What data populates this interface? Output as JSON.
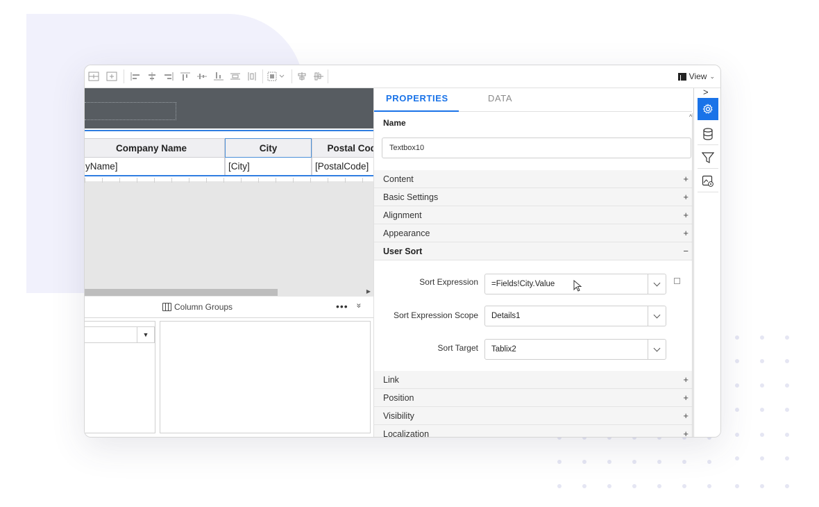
{
  "toolbar": {
    "icons": [
      "insert-row-above-icon",
      "insert-row-below-icon",
      "align-left-icon",
      "align-center-icon",
      "align-right-icon",
      "align-top-icon",
      "align-middle-icon",
      "align-bottom-icon",
      "distribute-horizontal-icon",
      "distribute-vertical-icon",
      "size-icon",
      "center-horizontal-icon",
      "center-vertical-icon"
    ],
    "view_label": "View"
  },
  "table": {
    "headers": [
      "Company Name",
      "City",
      "Postal Cod"
    ],
    "cells": [
      "yName]",
      "[City]",
      "[PostalCode]"
    ]
  },
  "groups": {
    "column_groups_label": "Column Groups",
    "more": "•••",
    "collapse": "»"
  },
  "properties": {
    "tabs": [
      "PROPERTIES",
      "DATA"
    ],
    "name_label": "Name",
    "name_value": "Textbox10",
    "categories_top": [
      {
        "label": "Content",
        "sign": "+"
      },
      {
        "label": "Basic Settings",
        "sign": "+"
      },
      {
        "label": "Alignment",
        "sign": "+"
      },
      {
        "label": "Appearance",
        "sign": "+"
      },
      {
        "label": "User Sort",
        "sign": "−"
      }
    ],
    "user_sort": {
      "sort_expression_label": "Sort Expression",
      "sort_expression_value": "=Fields!City.Value",
      "scope_label": "Sort Expression Scope",
      "scope_value": "Details1",
      "target_label": "Sort Target",
      "target_value": "Tablix2"
    },
    "categories_bottom": [
      {
        "label": "Link",
        "sign": "+"
      },
      {
        "label": "Position",
        "sign": "+"
      },
      {
        "label": "Visibility",
        "sign": "+"
      },
      {
        "label": "Localization",
        "sign": "+"
      }
    ]
  },
  "rail": {
    "collapse": ">",
    "icons": [
      "gear-icon",
      "database-icon",
      "filter-icon",
      "image-settings-icon"
    ],
    "accent": "#1a73e8"
  }
}
